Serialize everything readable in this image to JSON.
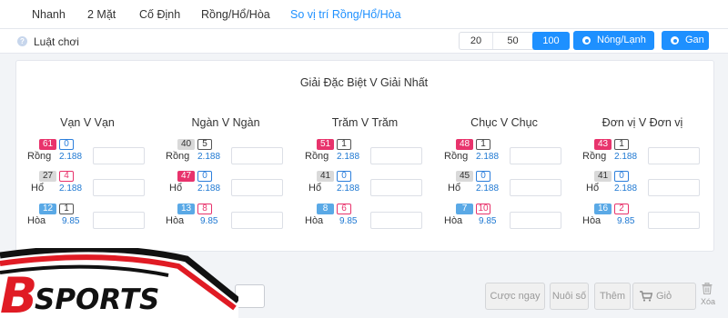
{
  "tabs": [
    {
      "label": "Nhanh",
      "active": false
    },
    {
      "label": "2 Mặt",
      "active": false
    },
    {
      "label": "Cố Định",
      "active": false
    },
    {
      "label": "Rồng/Hổ/Hòa",
      "active": false
    },
    {
      "label": "So vị trí Rồng/Hổ/Hòa",
      "active": true
    }
  ],
  "rules": {
    "label": "Luật chơi",
    "icon": "help-icon"
  },
  "amounts": [
    "20",
    "50",
    "100"
  ],
  "selected_amount": "100",
  "buttons": {
    "hot_cold": "Nóng/Lạnh",
    "gan": "Gan"
  },
  "panel_title": "Giải Đặc Biệt V Giải Nhất",
  "columns": [
    {
      "title": "Vạn V Vạn",
      "rows": [
        {
          "n1": "61",
          "n2": "0",
          "name": "Rồng",
          "odds": "2.188"
        },
        {
          "n1": "27",
          "n2": "4",
          "name": "Hổ",
          "odds": "2.188"
        },
        {
          "n1": "12",
          "n2": "1",
          "name": "Hòa",
          "odds": "9.85"
        }
      ]
    },
    {
      "title": "Ngàn V Ngàn",
      "rows": [
        {
          "n1": "40",
          "n2": "5",
          "name": "Rồng",
          "odds": "2.188"
        },
        {
          "n1": "47",
          "n2": "0",
          "name": "Hổ",
          "odds": "2.188"
        },
        {
          "n1": "13",
          "n2": "8",
          "name": "Hòa",
          "odds": "9.85"
        }
      ]
    },
    {
      "title": "Trăm V Trăm",
      "rows": [
        {
          "n1": "51",
          "n2": "1",
          "name": "Rồng",
          "odds": "2.188"
        },
        {
          "n1": "41",
          "n2": "0",
          "name": "Hổ",
          "odds": "2.188"
        },
        {
          "n1": "8",
          "n2": "6",
          "name": "Hòa",
          "odds": "9.85"
        }
      ]
    },
    {
      "title": "Chục V Chục",
      "rows": [
        {
          "n1": "48",
          "n2": "1",
          "name": "Rồng",
          "odds": "2.188"
        },
        {
          "n1": "45",
          "n2": "0",
          "name": "Hổ",
          "odds": "2.188"
        },
        {
          "n1": "7",
          "n2": "10",
          "name": "Hòa",
          "odds": "9.85"
        }
      ]
    },
    {
      "title": "Đơn vị V Đơn vị",
      "rows": [
        {
          "n1": "43",
          "n2": "1",
          "name": "Rồng",
          "odds": "2.188"
        },
        {
          "n1": "41",
          "n2": "0",
          "name": "Hổ",
          "odds": "2.188"
        },
        {
          "n1": "16",
          "n2": "2",
          "name": "Hòa",
          "odds": "9.85"
        }
      ]
    }
  ],
  "bottom": {
    "bet_now": "Cược ngay",
    "nuoi_so": "Nuôi số",
    "them": "Thêm",
    "gio": "Giỏ",
    "xoa": "Xóa"
  },
  "logo": {
    "letter": "B",
    "text": "SPORTS"
  },
  "colors": {
    "accent": "#1e90ff",
    "hot": "#e8336c",
    "cold": "#5aa9e6",
    "neutral": "#d9d9d9",
    "odds": "#1e78d2",
    "logo_red": "#e01b24"
  }
}
